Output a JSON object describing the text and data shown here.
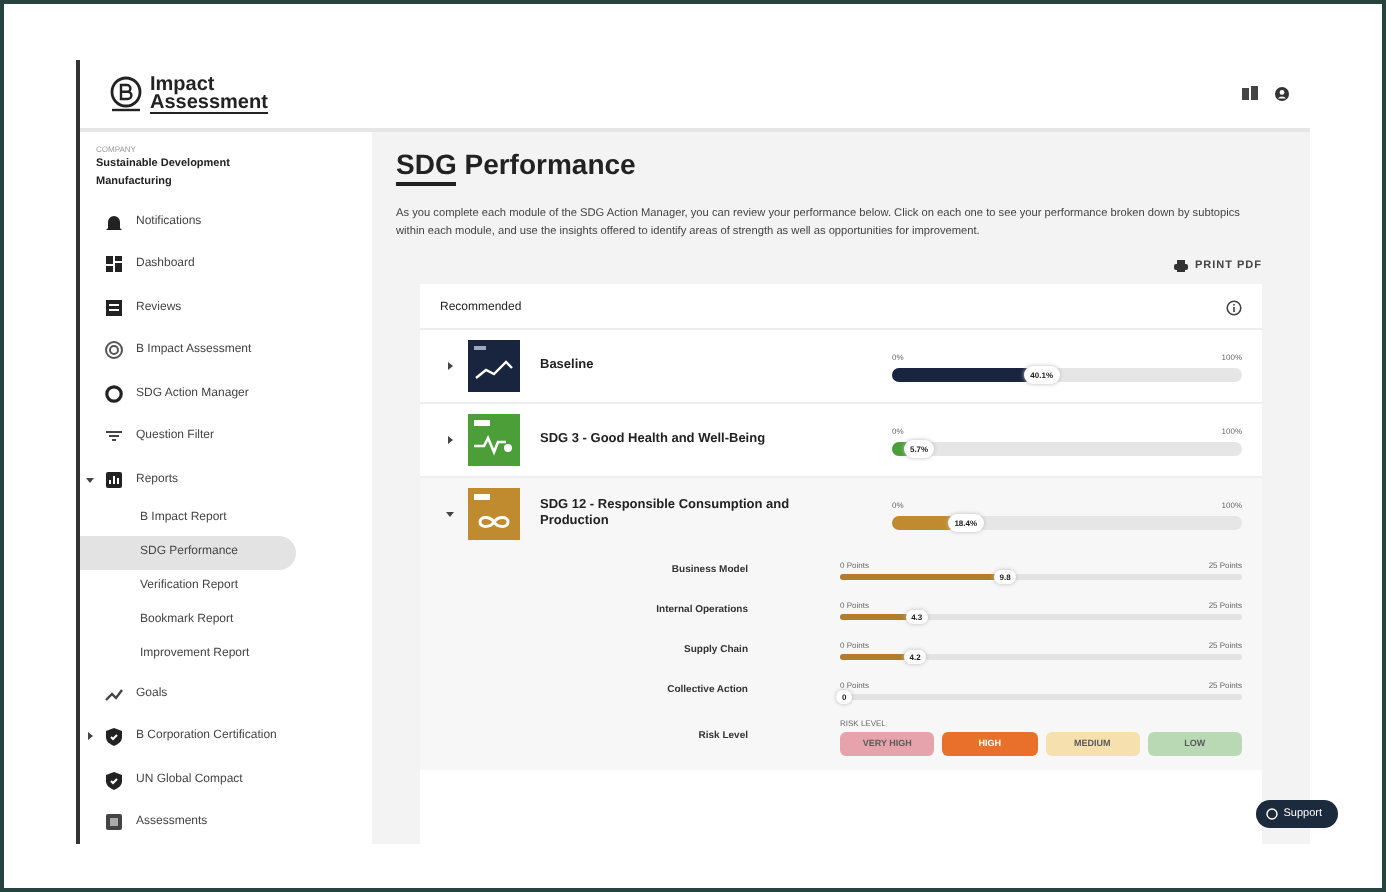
{
  "header": {
    "logo_top": "Impact",
    "logo_bottom": "Assessment"
  },
  "sidebar": {
    "company_label": "COMPANY",
    "company_name": "Sustainable Development Manufacturing",
    "items": [
      {
        "label": "Notifications",
        "selected": false
      },
      {
        "label": "Dashboard",
        "selected": false
      },
      {
        "label": "Reviews",
        "selected": false
      },
      {
        "label": "B Impact Assessment",
        "selected": false
      },
      {
        "label": "SDG Action Manager",
        "selected": false
      },
      {
        "label": "Question Filter",
        "selected": false
      },
      {
        "label": "Reports",
        "selected": false,
        "expanded": true,
        "children": [
          {
            "label": "B Impact Report",
            "selected": false
          },
          {
            "label": "SDG Performance",
            "selected": true
          },
          {
            "label": "Verification Report",
            "selected": false
          },
          {
            "label": "Bookmark Report",
            "selected": false
          },
          {
            "label": "Improvement Report",
            "selected": false
          }
        ]
      },
      {
        "label": "Goals",
        "selected": false
      },
      {
        "label": "B Corporation Certification",
        "selected": false,
        "expanded": false
      },
      {
        "label": "UN Global Compact",
        "selected": false
      },
      {
        "label": "Assessments",
        "selected": false
      }
    ]
  },
  "page": {
    "title": "SDG Performance",
    "intro": "As you complete each module of the SDG Action Manager, you can review your performance below. Click on each one to see your performance broken down by subtopics within each module, and use the insights offered to identify areas of strength as well as opportunities for improvement.",
    "print_button": "PRINT PDF"
  },
  "card": {
    "title": "Recommended",
    "modules": [
      {
        "name": "Baseline",
        "color": "#19243f",
        "expanded": false,
        "min": "0%",
        "max": "100%",
        "level": 0.401,
        "reading": "40.1%"
      },
      {
        "name": "SDG 3 - Good Health and Well-Being",
        "color": "#4c9f38",
        "expanded": false,
        "min": "0%",
        "max": "100%",
        "level": 0.057,
        "reading": "5.7%"
      },
      {
        "name": "SDG 12 - Responsible Consumption and Production",
        "color": "#bf8b2e",
        "expanded": true,
        "min": "0%",
        "max": "100%",
        "level": 0.184,
        "reading": "18.4%",
        "subtopics": [
          {
            "name": "Business Model",
            "min": "0 Points",
            "max": "25 Points",
            "level": 0.392,
            "reading": "9.8"
          },
          {
            "name": "Internal Operations",
            "min": "0 Points",
            "max": "25 Points",
            "level": 0.172,
            "reading": "4.3"
          },
          {
            "name": "Supply Chain",
            "min": "0 Points",
            "max": "25 Points",
            "level": 0.168,
            "reading": "4.2"
          },
          {
            "name": "Collective Action",
            "min": "0 Points",
            "max": "25 Points",
            "level": 0,
            "reading": "0"
          }
        ],
        "risk": {
          "name": "Risk Level",
          "caption": "RISK LEVEL",
          "levels": [
            {
              "label": "VERY HIGH",
              "color": "#e6a3ab",
              "selected": false
            },
            {
              "label": "HIGH",
              "color": "#e8702a",
              "selected": true
            },
            {
              "label": "MEDIUM",
              "color": "#f6e0ad",
              "selected": false
            },
            {
              "label": "LOW",
              "color": "#b9d9b5",
              "selected": false
            }
          ]
        }
      }
    ]
  },
  "support_button": "Support"
}
